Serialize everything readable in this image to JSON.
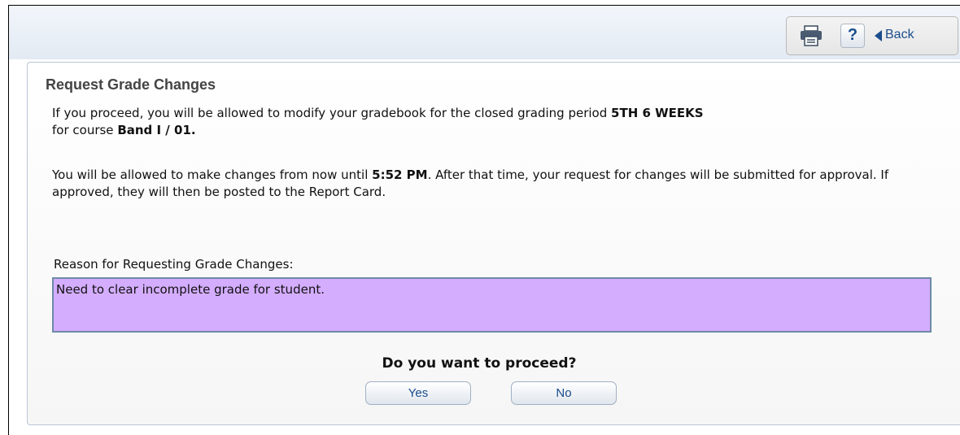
{
  "toolbar": {
    "print_icon": "printer-icon",
    "help_label": "?",
    "back_label": "Back",
    "back_icon": "back-arrow-icon"
  },
  "panel": {
    "title": "Request Grade Changes",
    "p1_text_a": "If you proceed, you will be allowed to modify your gradebook for the closed grading period ",
    "p1_period": "5TH 6 WEEKS",
    "p1_text_b": "for course ",
    "p1_course": "Band I / 01.",
    "p2_text_a": "You will be allowed to make changes from now until ",
    "p2_time": "5:52 PM",
    "p2_text_b": ". After that time, your request for changes will be submitted for approval. If approved, they will then be posted to the Report Card.",
    "reason_label": "Reason for Requesting Grade Changes:",
    "reason_value": "Need to clear incomplete grade for student.",
    "question": "Do you want to proceed?",
    "yes_label": "Yes",
    "no_label": "No"
  },
  "colors": {
    "reason_bg": "#d4adff",
    "accent": "#1a4c8c"
  }
}
